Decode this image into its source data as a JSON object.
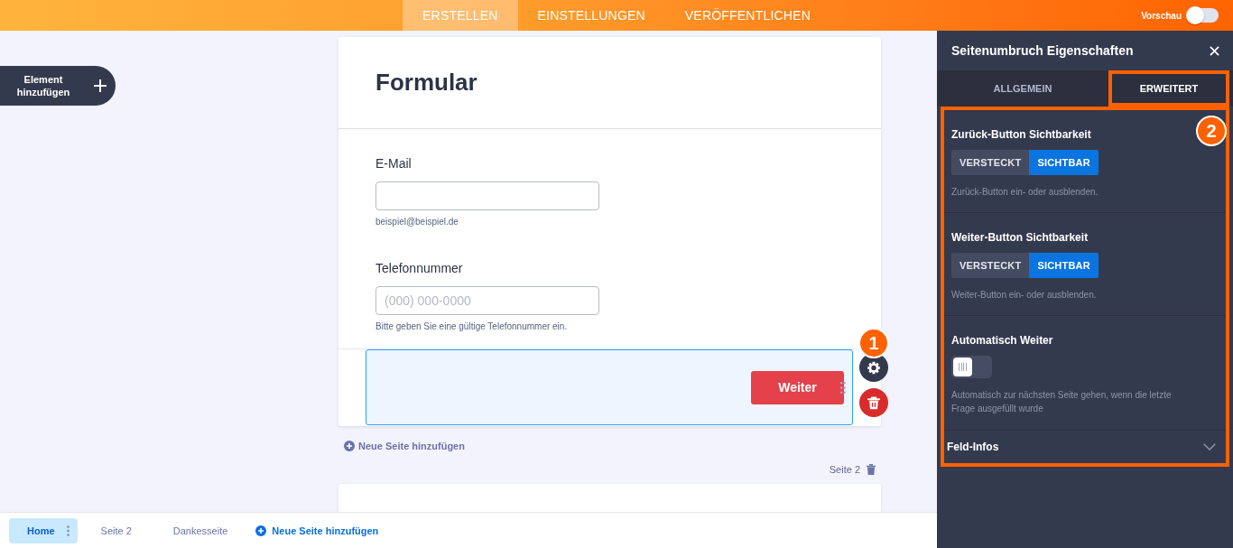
{
  "top_bar": {
    "tabs": [
      {
        "label": "ERSTELLEN",
        "selected": true
      },
      {
        "label": "EINSTELLUNGEN",
        "selected": false
      },
      {
        "label": "VERÖFFENTLICHEN",
        "selected": false
      }
    ],
    "preview": {
      "label": "Vorschau",
      "on": false
    }
  },
  "add_element_button": {
    "label": "Element hinzufügen"
  },
  "form": {
    "title": "Formular",
    "fields": [
      {
        "label": "E-Mail",
        "hint": "beispiel@beispiel.de"
      },
      {
        "label": "Telefonnummer",
        "placeholder": "(000) 000-0000",
        "hint": "Bitte geben Sie eine gültige Telefonnummer ein."
      }
    ],
    "page_break": {
      "selected": true,
      "button": "Weiter",
      "callout": "1"
    }
  },
  "add_page_link": {
    "label": "Neue Seite hinzufügen"
  },
  "next_page": {
    "label": "Seite 2"
  },
  "page_bar": {
    "pages": [
      {
        "label": "Home",
        "selected": true
      },
      {
        "label": "Seite 2",
        "selected": false
      },
      {
        "label": "Dankesseite",
        "selected": false
      }
    ],
    "add_page": "Neue Seite hinzufügen"
  },
  "panel": {
    "title": "Seitenumbruch Eigenschaften",
    "tabs": [
      {
        "label": "ALLGEMEIN",
        "selected": false,
        "highlighted": false
      },
      {
        "label": "ERWEITERT",
        "selected": true,
        "highlighted": true
      }
    ],
    "settings_highlighted": true,
    "callout": "2",
    "settings": [
      {
        "kind": "segmented",
        "label": "Zurück-Button Sichtbarkeit",
        "options": [
          {
            "label": "VERSTECKT",
            "selected": false
          },
          {
            "label": "SICHTBAR",
            "selected": true
          }
        ],
        "description": "Zurück-Button ein- oder ausblenden."
      },
      {
        "kind": "segmented",
        "label": "Weiter-Button Sichtbarkeit",
        "options": [
          {
            "label": "VERSTECKT",
            "selected": false
          },
          {
            "label": "SICHTBAR",
            "selected": true
          }
        ],
        "description": "Weiter-Button ein- oder ausblenden."
      },
      {
        "kind": "toggle",
        "label": "Automatisch Weiter",
        "on": false,
        "description": "Automatisch zur nächsten Seite gehen, wenn die letzte Frage ausgefüllt wurde"
      },
      {
        "kind": "collapsible",
        "label": "Feld-Infos",
        "expanded": false
      }
    ]
  }
}
